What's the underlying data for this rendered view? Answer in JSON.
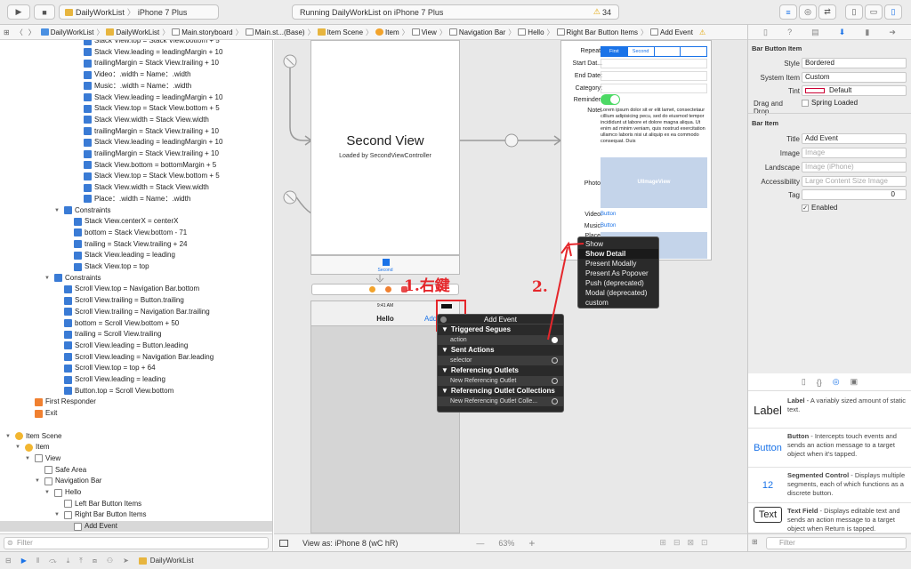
{
  "toolbar": {
    "scheme_name": "DailyWorkList",
    "device": "iPhone 7 Plus",
    "status_text": "Running DailyWorkList on iPhone 7 Plus",
    "warning_count": "34"
  },
  "jump_bar": [
    "DailyWorkList",
    "DailyWorkList",
    "Main.storyboard",
    "Main.st...(Base)",
    "Item Scene",
    "Item",
    "View",
    "Navigation Bar",
    "Hello",
    "Right Bar Button Items",
    "Add Event"
  ],
  "outline": {
    "rows": [
      {
        "text": "Stack View.top = Stack View.bottom + 5",
        "indent": 7
      },
      {
        "text": "Stack View.leading = leadingMargin + 10",
        "indent": 7
      },
      {
        "text": "trailingMargin = Stack View.trailing + 10",
        "indent": 7
      },
      {
        "text": "Video：.width = Name：.width",
        "indent": 7
      },
      {
        "text": "Music：.width = Name：.width",
        "indent": 7
      },
      {
        "text": "Stack View.leading = leadingMargin + 10",
        "indent": 7
      },
      {
        "text": "Stack View.top = Stack View.bottom + 5",
        "indent": 7
      },
      {
        "text": "Stack View.width = Stack View.width",
        "indent": 7
      },
      {
        "text": "trailingMargin = Stack View.trailing + 10",
        "indent": 7
      },
      {
        "text": "Stack View.leading = leadingMargin + 10",
        "indent": 7
      },
      {
        "text": "trailingMargin = Stack View.trailing + 10",
        "indent": 7
      },
      {
        "text": "Stack View.bottom = bottomMargin + 5",
        "indent": 7
      },
      {
        "text": "Stack View.top = Stack View.bottom + 5",
        "indent": 7
      },
      {
        "text": "Stack View.width = Stack View.width",
        "indent": 7
      },
      {
        "text": "Place：.width = Name：.width",
        "indent": 7
      },
      {
        "text": "Constraints",
        "indent": 5,
        "tri": "▼"
      },
      {
        "text": "Stack View.centerX = centerX",
        "indent": 6
      },
      {
        "text": "bottom = Stack View.bottom - 71",
        "indent": 6
      },
      {
        "text": "trailing = Stack View.trailing + 24",
        "indent": 6
      },
      {
        "text": "Stack View.leading = leading",
        "indent": 6
      },
      {
        "text": "Stack View.top = top",
        "indent": 6
      },
      {
        "text": "Constraints",
        "indent": 4,
        "tri": "▼"
      },
      {
        "text": "Scroll View.top = Navigation Bar.bottom",
        "indent": 5
      },
      {
        "text": "Scroll View.trailing = Button.trailing",
        "indent": 5
      },
      {
        "text": "Scroll View.trailing = Navigation Bar.trailing",
        "indent": 5
      },
      {
        "text": "bottom = Scroll View.bottom + 50",
        "indent": 5
      },
      {
        "text": "trailing = Scroll View.trailing",
        "indent": 5
      },
      {
        "text": "Scroll View.leading = Button.leading",
        "indent": 5
      },
      {
        "text": "Scroll View.leading = Navigation Bar.leading",
        "indent": 5
      },
      {
        "text": "Scroll View.top = top + 64",
        "indent": 5
      },
      {
        "text": "Scroll View.leading = leading",
        "indent": 5
      },
      {
        "text": "Button.top = Scroll View.bottom",
        "indent": 5
      },
      {
        "text": "First Responder",
        "indent": 2,
        "kind": "orange"
      },
      {
        "text": "Exit",
        "indent": 2,
        "kind": "orange"
      },
      {
        "text": "",
        "indent": 0,
        "kind": "spacer"
      },
      {
        "text": "Item Scene",
        "indent": 0,
        "tri": "▼",
        "kind": "yellow"
      },
      {
        "text": "Item",
        "indent": 1,
        "tri": "▼",
        "kind": "yellow"
      },
      {
        "text": "View",
        "indent": 2,
        "tri": "▼",
        "kind": "white"
      },
      {
        "text": "Safe Area",
        "indent": 3,
        "kind": "white"
      },
      {
        "text": "Navigation Bar",
        "indent": 3,
        "tri": "▼",
        "kind": "white"
      },
      {
        "text": "Hello",
        "indent": 4,
        "tri": "▼",
        "kind": "white"
      },
      {
        "text": "Left Bar Button Items",
        "indent": 5,
        "kind": "white"
      },
      {
        "text": "Right Bar Button Items",
        "indent": 5,
        "tri": "▼",
        "kind": "white"
      },
      {
        "text": "Add Event",
        "indent": 6,
        "kind": "white",
        "selected": true
      }
    ],
    "filter_placeholder": "Filter"
  },
  "canvas": {
    "second_view_title": "Second View",
    "second_view_sub": "Loaded by SecondViewController",
    "tab_label": "Second",
    "phone_time": "9:41 AM",
    "nav_title": "Hello",
    "nav_right": "Add",
    "form": {
      "repeat_label": "Repeat:",
      "seg_first": "First",
      "seg_second": "Second",
      "start_label": "Start Dat...",
      "end_label": "End Date:",
      "category_label": "Category:",
      "reminder_label": "Reminder:",
      "note_label": "Note:",
      "note_text": "Lorem ipsum dolor sit er elit lamet, consectetaur cillium adipisicing pecu, sed do eiusmod tempor incididunt ut labore et dolore magna aliqua. Ut enim ad minim veniam, quis nostrud exercitation ullamco laboris nisi ut aliquip ex ea commodo consequat. Duis",
      "photo_label": "Photo:",
      "image_view": "UIImageView",
      "video_label": "Video:",
      "video_btn": "Button",
      "music_label": "Music:",
      "music_btn": "Button",
      "place_label": "Place:"
    },
    "annotation_1": "1.右鍵",
    "annotation_2": "2."
  },
  "segue_menu": [
    "Show",
    "Show Detail",
    "Present Modally",
    "Present As Popover",
    "Push (deprecated)",
    "Modal (deprecated)",
    "custom"
  ],
  "connections": {
    "title": "Add Event",
    "triggered": "Triggered Segues",
    "action": "action",
    "sent": "Sent Actions",
    "selector": "selector",
    "outlets": "Referencing Outlets",
    "new_outlet": "New Referencing Outlet",
    "collections": "Referencing Outlet Collections",
    "new_collection": "New Referencing Outlet Colle..."
  },
  "bottombar": {
    "view_as": "View as: iPhone 8 (wC hR)",
    "zoom": "63%"
  },
  "statusbar": {
    "target": "DailyWorkList"
  },
  "inspector": {
    "section1": "Bar Button Item",
    "style_label": "Style",
    "style_value": "Bordered",
    "system_label": "System Item",
    "system_value": "Custom",
    "tint_label": "Tint",
    "tint_value": "Default",
    "dragdrop_label": "Drag and Drop",
    "spring_label": "Spring Loaded",
    "section2": "Bar Item",
    "title_label": "Title",
    "title_value": "Add Event",
    "image_label": "Image",
    "image_ph": "Image",
    "landscape_label": "Landscape",
    "landscape_ph": "Image (iPhone)",
    "access_label": "Accessibility",
    "access_ph": "Large Content Size Image",
    "tag_label": "Tag",
    "tag_value": "0",
    "enabled_label": "Enabled"
  },
  "library": [
    {
      "title": "Label",
      "desc": "A variably sized amount of static text.",
      "icon": "Label"
    },
    {
      "title": "Button",
      "desc": "Intercepts touch events and sends an action message to a target object when it's tapped.",
      "icon": "Button"
    },
    {
      "title": "Segmented Control",
      "desc": "Displays multiple segments, each of which functions as a discrete button.",
      "icon": "12"
    },
    {
      "title": "Text Field",
      "desc": "Displays editable text and sends an action message to a target object when Return is tapped.",
      "icon": "Text"
    }
  ],
  "library_filter": "Filter",
  "colors": {
    "accent": "#1a73e8",
    "annotation": "#e5262b",
    "toggle": "#4cd964"
  }
}
